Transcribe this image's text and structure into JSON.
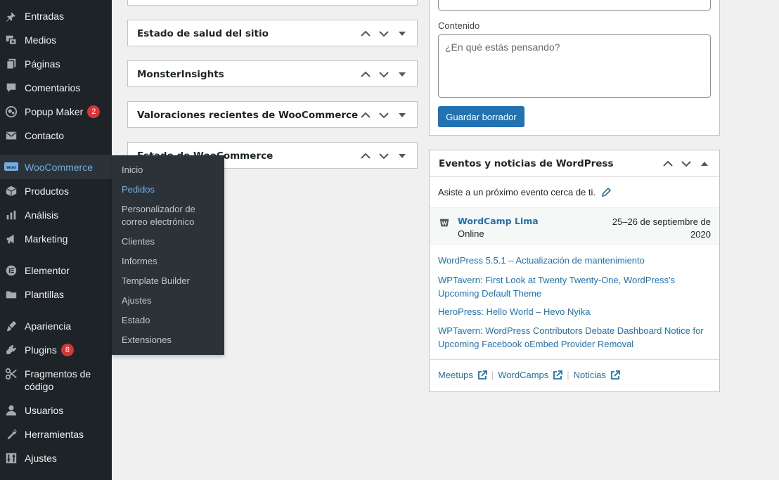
{
  "sidebar": {
    "items": [
      {
        "label": "Entradas",
        "icon": "pin-icon"
      },
      {
        "label": "Medios",
        "icon": "media-icon"
      },
      {
        "label": "Páginas",
        "icon": "pages-icon"
      },
      {
        "label": "Comentarios",
        "icon": "comments-icon"
      },
      {
        "label": "Popup Maker",
        "icon": "popup-icon",
        "badge": "2"
      },
      {
        "label": "Contacto",
        "icon": "mail-icon"
      },
      {
        "label": "WooCommerce",
        "icon": "woo-icon"
      },
      {
        "label": "Productos",
        "icon": "box-icon"
      },
      {
        "label": "Análisis",
        "icon": "chart-icon"
      },
      {
        "label": "Marketing",
        "icon": "megaphone-icon"
      },
      {
        "label": "Elementor",
        "icon": "elementor-icon"
      },
      {
        "label": "Plantillas",
        "icon": "folder-icon"
      },
      {
        "label": "Apariencia",
        "icon": "brush-icon"
      },
      {
        "label": "Plugins",
        "icon": "plugin-icon",
        "badge": "8"
      },
      {
        "label": "Fragmentos de código",
        "icon": "scissors-icon"
      },
      {
        "label": "Usuarios",
        "icon": "user-icon"
      },
      {
        "label": "Herramientas",
        "icon": "wrench-icon"
      },
      {
        "label": "Ajustes",
        "icon": "settings-icon"
      }
    ]
  },
  "woo_submenu": {
    "items": [
      "Inicio",
      "Pedidos",
      "Personalizador de correo electrónico",
      "Clientes",
      "Informes",
      "Template Builder",
      "Ajustes",
      "Estado",
      "Extensiones"
    ],
    "current": "Pedidos"
  },
  "left_boxes": {
    "titles": [
      "Estado de salud del sitio",
      "MonsterInsights",
      "Valoraciones recientes de WooCommerce",
      "Estado de WooCommerce"
    ]
  },
  "draft": {
    "content_label": "Contenido",
    "placeholder": "¿En qué estás pensando?",
    "save_label": "Guardar borrador"
  },
  "events": {
    "title": "Eventos y noticias de WordPress",
    "intro": "Asiste a un próximo evento cerca de ti.",
    "event_name": "WordCamp Lima",
    "event_location": "Online",
    "event_date": "25–26 de septiembre de 2020",
    "news": [
      "WordPress 5.5.1 – Actualización de mantenimiento",
      "WPTavern: First Look at Twenty Twenty-One, WordPress's Upcoming Default Theme",
      "HeroPress: Hello World – Hevo Nyika",
      "WPTavern: WordPress Contributors Debate Dashboard Notice for Upcoming Facebook oEmbed Provider Removal"
    ],
    "footer_links": [
      "Meetups",
      "WordCamps",
      "Noticias"
    ]
  },
  "colors": {
    "sidebar_bg": "#1d2327",
    "flyout_bg": "#2c3338",
    "accent": "#72aee6",
    "link": "#2271b1",
    "badge": "#d63638"
  }
}
